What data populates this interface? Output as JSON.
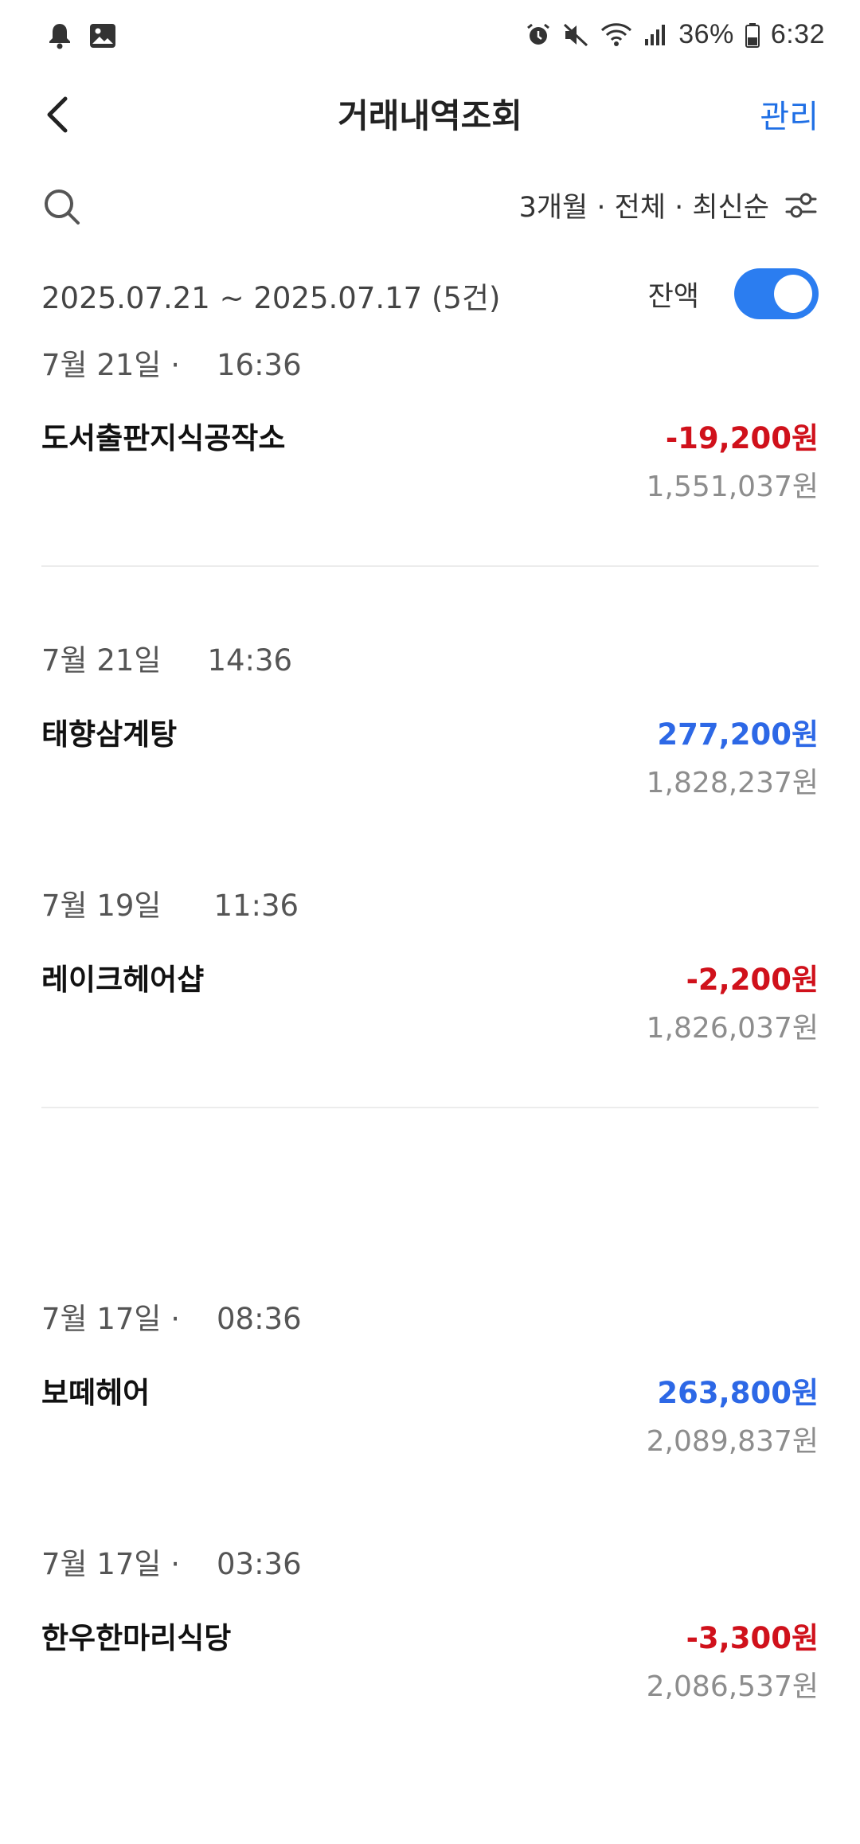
{
  "status_bar": {
    "battery": "36%",
    "time": "6:32"
  },
  "header": {
    "title": "거래내역조회",
    "manage_label": "관리"
  },
  "filter": {
    "label": "3개월 · 전체 · 최신순"
  },
  "summary": {
    "date_range": "2025.07.21 ~ 2025.07.17 (5건)",
    "balance_label": "잔액",
    "balance_toggle_on": true
  },
  "transactions": [
    {
      "date": "7월 21일 ·",
      "time": "16:36",
      "name": "도서출판지식공작소",
      "amount": "-19,200원",
      "balance": "1,551,037원",
      "type": "withdrawal"
    },
    {
      "date": "7월 21일",
      "time": "14:36",
      "name": "태향삼계탕",
      "amount": "277,200원",
      "balance": "1,828,237원",
      "type": "deposit"
    },
    {
      "date": "7월 19일",
      "time": "11:36",
      "name": "레이크헤어샵",
      "amount": "-2,200원",
      "balance": "1,826,037원",
      "type": "withdrawal"
    },
    {
      "date": "7월 17일 ·",
      "time": "08:36",
      "name": "보떼헤어",
      "amount": "263,800원",
      "balance": "2,089,837원",
      "type": "deposit"
    },
    {
      "date": "7월 17일 ·",
      "time": "03:36",
      "name": "한우한마리식당",
      "amount": "-3,300원",
      "balance": "2,086,537원",
      "type": "withdrawal"
    }
  ],
  "colors": {
    "accent": "#1f6fe5",
    "toggle": "#2b7df0",
    "negative": "#d0111b",
    "positive": "#2d68e6"
  }
}
